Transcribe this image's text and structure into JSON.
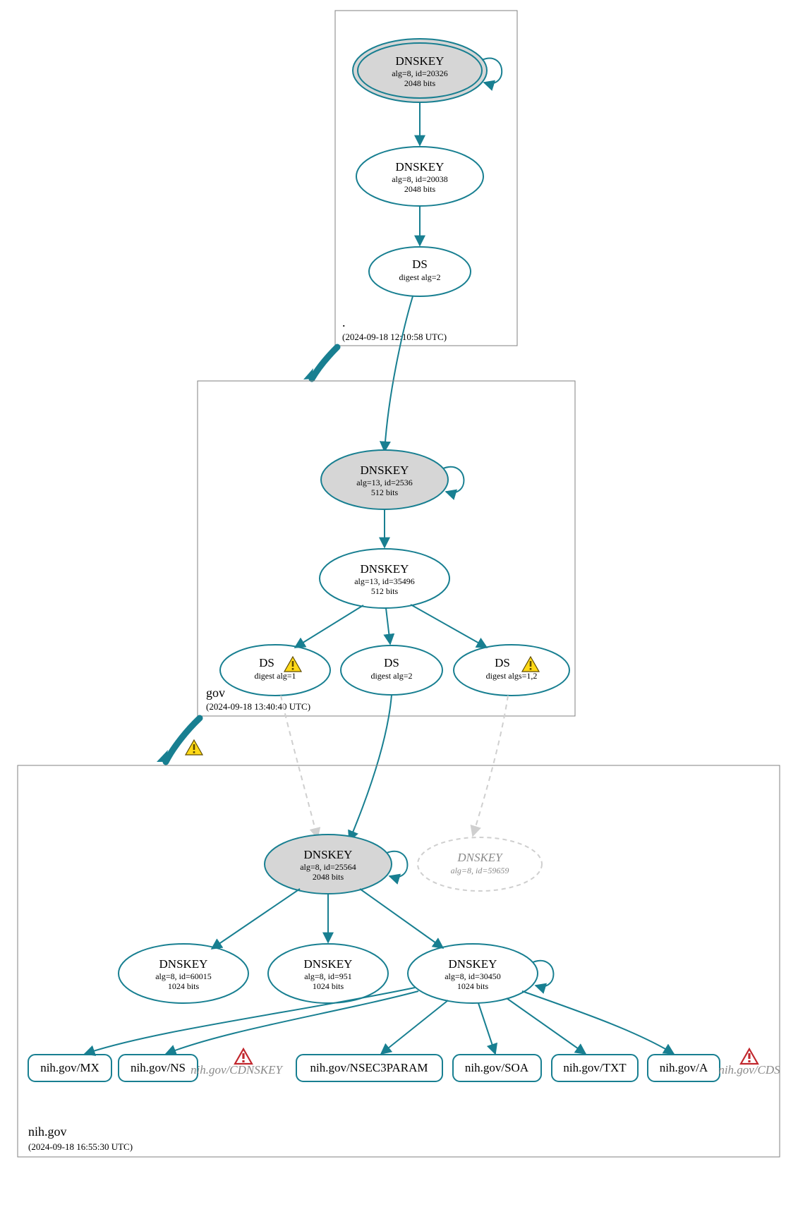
{
  "colors": {
    "accent": "#187F91",
    "node_grey": "#d6d6d6",
    "muted": "#cfcfcf"
  },
  "zones": [
    {
      "name": ".",
      "timestamp": "(2024-09-18 12:10:58 UTC)"
    },
    {
      "name": "gov",
      "timestamp": "(2024-09-18 13:40:40 UTC)"
    },
    {
      "name": "nih.gov",
      "timestamp": "(2024-09-18 16:55:30 UTC)"
    }
  ],
  "root": {
    "ksk": {
      "title": "DNSKEY",
      "sub1": "alg=8, id=20326",
      "sub2": "2048 bits"
    },
    "zsk": {
      "title": "DNSKEY",
      "sub1": "alg=8, id=20038",
      "sub2": "2048 bits"
    },
    "ds": {
      "title": "DS",
      "sub1": "digest alg=2"
    }
  },
  "gov": {
    "ksk": {
      "title": "DNSKEY",
      "sub1": "alg=13, id=2536",
      "sub2": "512 bits"
    },
    "zsk": {
      "title": "DNSKEY",
      "sub1": "alg=13, id=35496",
      "sub2": "512 bits"
    },
    "ds1": {
      "title": "DS",
      "sub1": "digest alg=1"
    },
    "ds2": {
      "title": "DS",
      "sub1": "digest alg=2"
    },
    "ds3": {
      "title": "DS",
      "sub1": "digest algs=1,2"
    }
  },
  "nih": {
    "ksk": {
      "title": "DNSKEY",
      "sub1": "alg=8, id=25564",
      "sub2": "2048 bits"
    },
    "ghost": {
      "title": "DNSKEY",
      "sub1": "alg=8, id=59659"
    },
    "z1": {
      "title": "DNSKEY",
      "sub1": "alg=8, id=60015",
      "sub2": "1024 bits"
    },
    "z2": {
      "title": "DNSKEY",
      "sub1": "alg=8, id=951",
      "sub2": "1024 bits"
    },
    "z3": {
      "title": "DNSKEY",
      "sub1": "alg=8, id=30450",
      "sub2": "1024 bits"
    }
  },
  "rrsets": {
    "mx": "nih.gov/MX",
    "ns": "nih.gov/NS",
    "cdk": "nih.gov/CDNSKEY",
    "n3p": "nih.gov/NSEC3PARAM",
    "soa": "nih.gov/SOA",
    "txt": "nih.gov/TXT",
    "a": "nih.gov/A",
    "cds": "nih.gov/CDS"
  }
}
